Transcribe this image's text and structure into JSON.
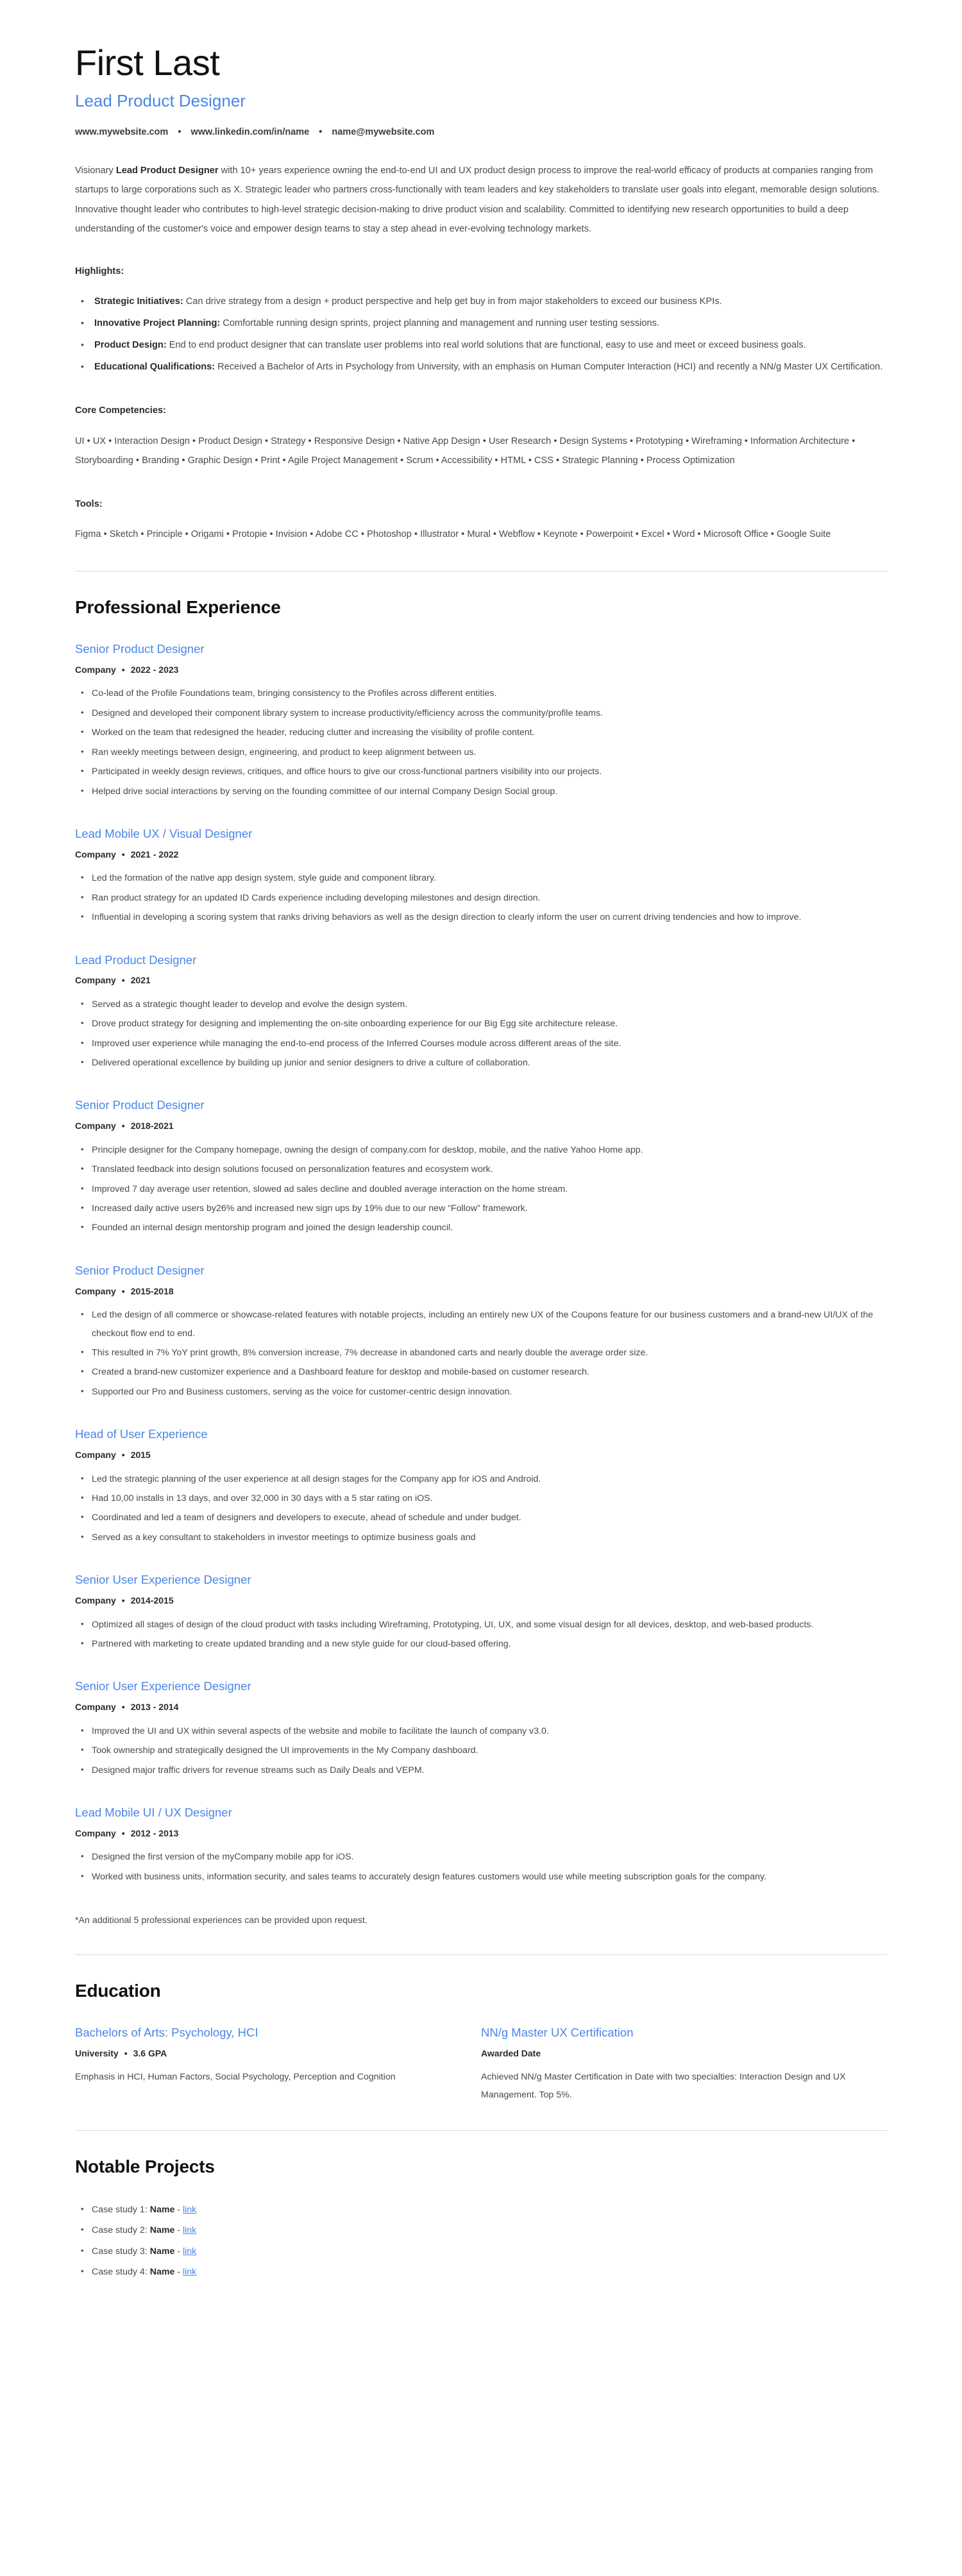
{
  "accent_color": "#4a86e8",
  "text_color": "#4a4a4a",
  "divider_color": "#d9d9d9",
  "header": {
    "name": "First Last",
    "headline": "Lead Product Designer",
    "contact": {
      "website": "www.mywebsite.com",
      "linkedin": "www.linkedin.com/in/name",
      "email": "name@mywebsite.com",
      "separator": "•"
    }
  },
  "summary": {
    "lead_in": "Visionary ",
    "bold_phrase": "Lead Product Designer",
    "rest": " with 10+ years experience owning the end-to-end UI and UX product design process to improve the real-world efficacy of products at companies ranging from startups to large corporations such as X. Strategic leader who partners cross-functionally with team leaders and key stakeholders to translate user goals into elegant, memorable design solutions. Innovative thought leader who contributes to high-level strategic decision-making to drive product vision and scalability. Committed to identifying new research opportunities to build a deep understanding of the customer's voice and empower design teams to stay a step ahead in ever-evolving technology markets."
  },
  "highlights": {
    "heading": "Highlights:",
    "items": [
      {
        "label": "Strategic Initiatives:",
        "text": " Can drive strategy from a design + product perspective and help get buy in from major stakeholders to exceed our business KPIs."
      },
      {
        "label": "Innovative Project Planning:",
        "text": " Comfortable running design sprints, project planning and management and running user testing sessions."
      },
      {
        "label": "Product Design:",
        "text": " End to end product designer that can translate user problems into real world solutions that are functional, easy to use and meet or exceed business goals."
      },
      {
        "label": "Educational Qualifications:",
        "text": " Received a Bachelor of Arts in Psychology from University,  with an emphasis on Human Computer Interaction (HCI) and recently a NN/g Master UX Certification."
      }
    ]
  },
  "core_competencies": {
    "heading": "Core Competencies:",
    "text": "UI • UX • Interaction Design • Product Design • Strategy • Responsive Design • Native App Design • User Research • Design Systems • Prototyping • Wireframing • Information Architecture • Storyboarding • Branding • Graphic Design • Print • Agile Project Management • Scrum • Accessibility • HTML • CSS • Strategic Planning • Process Optimization"
  },
  "tools": {
    "heading": "Tools:",
    "text": "Figma • Sketch • Principle • Origami • Protopie • Invision • Adobe CC • Photoshop • Illustrator • Mural • Webflow • Keynote • Powerpoint • Excel • Word • Microsoft Office • Google Suite"
  },
  "experience": {
    "section_title": "Professional Experience",
    "separator": "•",
    "jobs": [
      {
        "title": "Senior Product Designer",
        "company": "Company",
        "dates": "2022 - 2023",
        "duties": [
          "Co-lead of the Profile Foundations team, bringing consistency to the Profiles across different entities.",
          "Designed and developed their component library system to increase productivity/efficiency across the community/profile teams.",
          "Worked on the team that redesigned the header, reducing clutter and increasing the visibility of profile content.",
          "Ran weekly meetings between design, engineering, and product to keep alignment between us.",
          "Participated in weekly design reviews, critiques, and office hours to give our cross-functional partners visibility into our projects.",
          "Helped drive social interactions by serving on the founding committee of our internal Company Design Social group."
        ]
      },
      {
        "title": "Lead Mobile UX / Visual Designer",
        "company": "Company",
        "dates": "2021 - 2022",
        "duties": [
          "Led the formation of the native app design system, style guide and component library.",
          "Ran product strategy for an updated ID Cards experience including developing milestones and design direction.",
          "Influential in developing a scoring system that ranks driving behaviors as well as the design direction to clearly inform the user on current driving tendencies and how to improve."
        ]
      },
      {
        "title": "Lead Product Designer",
        "company": "Company",
        "dates": "2021",
        "duties": [
          "Served as a strategic thought leader to develop and evolve the design system.",
          "Drove product strategy for designing and implementing the on-site onboarding experience for our Big Egg site architecture release.",
          "Improved user experience while managing the end-to-end process of the Inferred Courses module across different areas of the site.",
          "Delivered operational excellence by building up junior and senior designers to drive a culture of collaboration."
        ]
      },
      {
        "title": "Senior Product Designer",
        "company": "Company",
        "dates": "2018-2021",
        "duties": [
          "Principle designer for the Company homepage, owning the design of company.com for desktop, mobile, and the native Yahoo Home app.",
          "Translated feedback into design solutions focused on personalization features and ecosystem work.",
          "Improved 7 day average user retention, slowed ad sales decline and doubled average interaction on the home stream.",
          "Increased daily active users by26% and increased new sign ups by 19% due to our new “Follow” framework.",
          "Founded an internal design mentorship program and joined the design leadership council."
        ]
      },
      {
        "title": "Senior Product Designer",
        "company": "Company",
        "dates": "2015-2018",
        "duties": [
          "Led the design of all commerce or showcase-related features with notable projects, including an entirely new UX of the Coupons feature for our business customers and a brand-new UI/UX of the checkout flow end to end.",
          "This resulted in 7% YoY print growth, 8% conversion increase, 7% decrease in abandoned carts and nearly double the average order size.",
          "Created a brand-new customizer experience and a Dashboard feature for desktop and mobile-based on customer research.",
          "Supported our Pro and Business customers, serving as the voice for customer-centric design innovation."
        ]
      },
      {
        "title": "Head of User Experience",
        "company": "Company",
        "dates": "2015",
        "duties": [
          "Led the strategic planning of the user experience at all design stages for the Company app for iOS and Android.",
          "Had 10,00 installs in 13 days, and over 32,000 in 30 days with a 5 star rating on iOS.",
          "Coordinated and led a team of designers and developers to execute, ahead of schedule and under budget.",
          "Served as a key consultant to stakeholders in investor meetings to optimize business goals and"
        ]
      },
      {
        "title": "Senior User Experience Designer",
        "company": "Company",
        "dates": "2014-2015",
        "duties": [
          "Optimized all stages of design of the cloud product with tasks including Wireframing, Prototyping, UI, UX, and some visual design for all devices, desktop, and web-based products.",
          "Partnered with marketing to create updated branding and a new style guide for our cloud-based offering."
        ]
      },
      {
        "title": "Senior User Experience Designer",
        "company": "Company",
        "dates": "2013 - 2014",
        "duties": [
          "Improved the UI and UX within several aspects of the website and mobile to facilitate the launch of company v3.0.",
          "Took ownership and strategically designed the UI improvements in the My Company dashboard.",
          "Designed major traffic drivers for revenue streams such as Daily Deals and VEPM."
        ]
      },
      {
        "title": "Lead Mobile UI / UX Designer",
        "company": "Company",
        "dates": "2012 - 2013",
        "duties": [
          "Designed the first version of the myCompany mobile app for iOS.",
          "Worked with business units, information security, and sales teams to accurately design features customers would use while meeting subscription goals for the company."
        ]
      }
    ],
    "footnote": "*An additional 5 professional experiences can be provided upon request."
  },
  "education": {
    "section_title": "Education",
    "separator": "•",
    "entries": [
      {
        "title": "Bachelors of Arts: Psychology, HCI",
        "institution": "University",
        "detail": "3.6 GPA",
        "description": "Emphasis in HCI, Human Factors, Social Psychology, Perception and Cognition"
      },
      {
        "title": "NN/g Master UX Certification",
        "institution": "Awarded Date",
        "detail": "",
        "description": "Achieved NN/g Master Certification in Date with two specialties: Interaction Design and UX Management. Top 5%."
      }
    ]
  },
  "projects": {
    "section_title": "Notable Projects",
    "items": [
      {
        "prefix": "Case study 1: ",
        "name": "Name",
        "dash": " - ",
        "link_label": "link"
      },
      {
        "prefix": "Case study 2: ",
        "name": "Name",
        "dash": " - ",
        "link_label": "link"
      },
      {
        "prefix": "Case study 3: ",
        "name": "Name",
        "dash": " - ",
        "link_label": "link"
      },
      {
        "prefix": "Case study 4: ",
        "name": "Name",
        "dash": " - ",
        "link_label": "link"
      }
    ]
  }
}
